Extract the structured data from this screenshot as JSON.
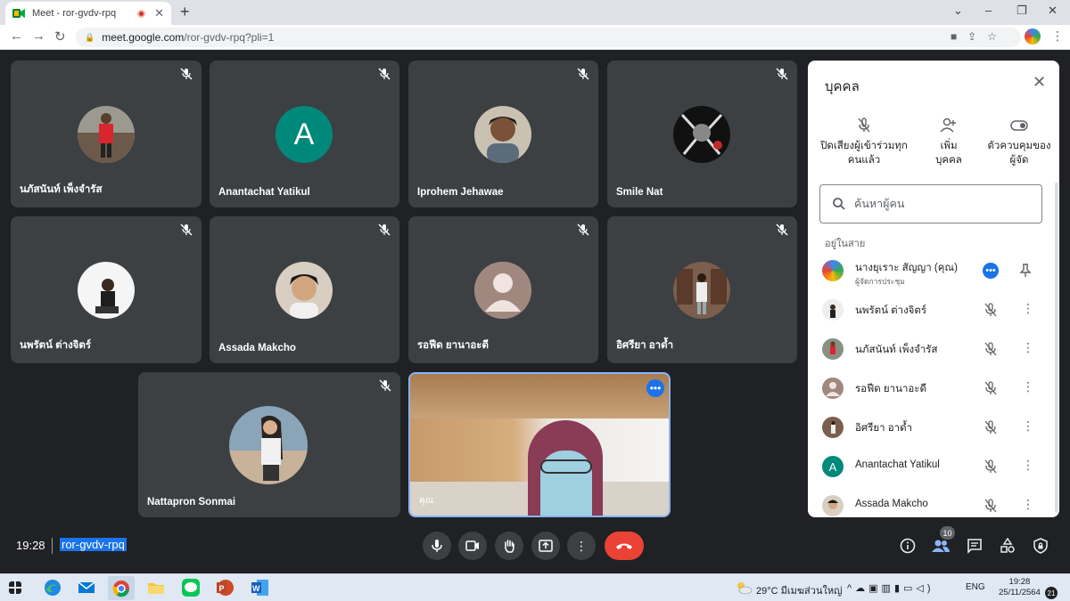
{
  "browser": {
    "tab_title": "Meet - ror-gvdv-rpq",
    "url_host": "meet.google.com",
    "url_path": "/ror-gvdv-rpq?pli=1",
    "new_tab_symbol": "+",
    "close_symbol": "✕"
  },
  "tiles": [
    {
      "name": "นภัสนันท์ เพ็งจำรัส"
    },
    {
      "name": "Anantachat Yatikul",
      "initial": "A"
    },
    {
      "name": "Iprohem Jehawae"
    },
    {
      "name": "Smile Nat"
    },
    {
      "name": "นพรัตน์ ต่างจิตร์"
    },
    {
      "name": "Assada Makcho"
    },
    {
      "name": "รอฟีด ยานาอะดี"
    },
    {
      "name": "อิศรียา อาด้ำ"
    },
    {
      "name": "Nattapron Sonmai"
    },
    {
      "name": "คุณ"
    }
  ],
  "bottom_bar": {
    "time": "19:28",
    "meeting_code": "ror-gvdv-rpq",
    "participant_count": "10"
  },
  "panel": {
    "title": "บุคคล",
    "actions": [
      {
        "line1": "ปิดเสียงผู้เข้าร่วมทุก",
        "line2": "คนแล้ว",
        "icon": "mic-off-icon"
      },
      {
        "line1": "เพิ่ม",
        "line2": "บุคคล",
        "icon": "person-add-icon"
      },
      {
        "line1": "ตัวควบคุมของ",
        "line2": "ผู้จัด",
        "icon": "toggle-icon"
      }
    ],
    "search_placeholder": "ค้นหาผู้คน",
    "section_label": "อยู่ในสาย",
    "people": [
      {
        "name": "นางยุเราะ สัญญา (คุณ)",
        "sub": "ผู้จัดการประชุม"
      },
      {
        "name": "นพรัตน์ ต่างจิตร์"
      },
      {
        "name": "นภัสนันท์ เพ็งจำรัส"
      },
      {
        "name": "รอฟีด ยานาอะดี"
      },
      {
        "name": "อิศรียา อาด้ำ"
      },
      {
        "name": "Anantachat Yatikul",
        "initial": "A"
      },
      {
        "name": "Assada Makcho"
      }
    ]
  },
  "taskbar": {
    "weather": "29°C มีเมฆส่วนใหญ่",
    "lang": "ENG",
    "time": "19:28",
    "date": "25/11/2564",
    "notifications": "21"
  },
  "colors": {
    "accent": "#1a73e8",
    "leave": "#ea4335",
    "tile_bg": "#3c4043",
    "bg": "#202124",
    "avatar_teal": "#00897b"
  }
}
